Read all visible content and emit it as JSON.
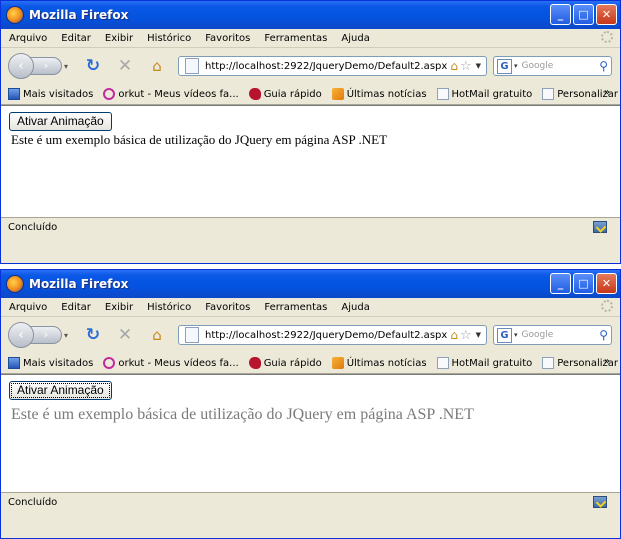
{
  "windows": [
    {
      "title": "Mozilla Firefox",
      "menu": [
        "Arquivo",
        "Editar",
        "Exibir",
        "Histórico",
        "Favoritos",
        "Ferramentas",
        "Ajuda"
      ],
      "url": "http://localhost:2922/JqueryDemo/Default2.aspx",
      "search_placeholder": "Google",
      "bookmarks": [
        "Mais visitados",
        "orkut - Meus vídeos fa...",
        "Guia rápido",
        "Últimas notícias",
        "HotMail gratuito",
        "Personalizar links"
      ],
      "button_label": "Ativar Animação",
      "content_text": "Este é um exemplo básica de utilização do JQuery em página ASP .NET",
      "status": "Concluído"
    },
    {
      "title": "Mozilla Firefox",
      "menu": [
        "Arquivo",
        "Editar",
        "Exibir",
        "Histórico",
        "Favoritos",
        "Ferramentas",
        "Ajuda"
      ],
      "url": "http://localhost:2922/JqueryDemo/Default2.aspx",
      "search_placeholder": "Google",
      "bookmarks": [
        "Mais visitados",
        "orkut - Meus vídeos fa...",
        "Guia rápido",
        "Últimas notícias",
        "HotMail gratuito",
        "Personalizar links"
      ],
      "button_label": "Ativar Animação",
      "content_text": "Este é um exemplo básica de utilização do JQuery em página ASP .NET",
      "status": "Concluído"
    }
  ],
  "colors": {
    "titlebar": "#0a58e6",
    "chrome": "#ece9d8",
    "animated_text": "#7a7a7a"
  },
  "icons": {
    "reload": "reload-icon",
    "stop": "stop-icon",
    "home": "home-icon",
    "bookmark_star": "star-icon",
    "search": "magnifier-icon"
  }
}
